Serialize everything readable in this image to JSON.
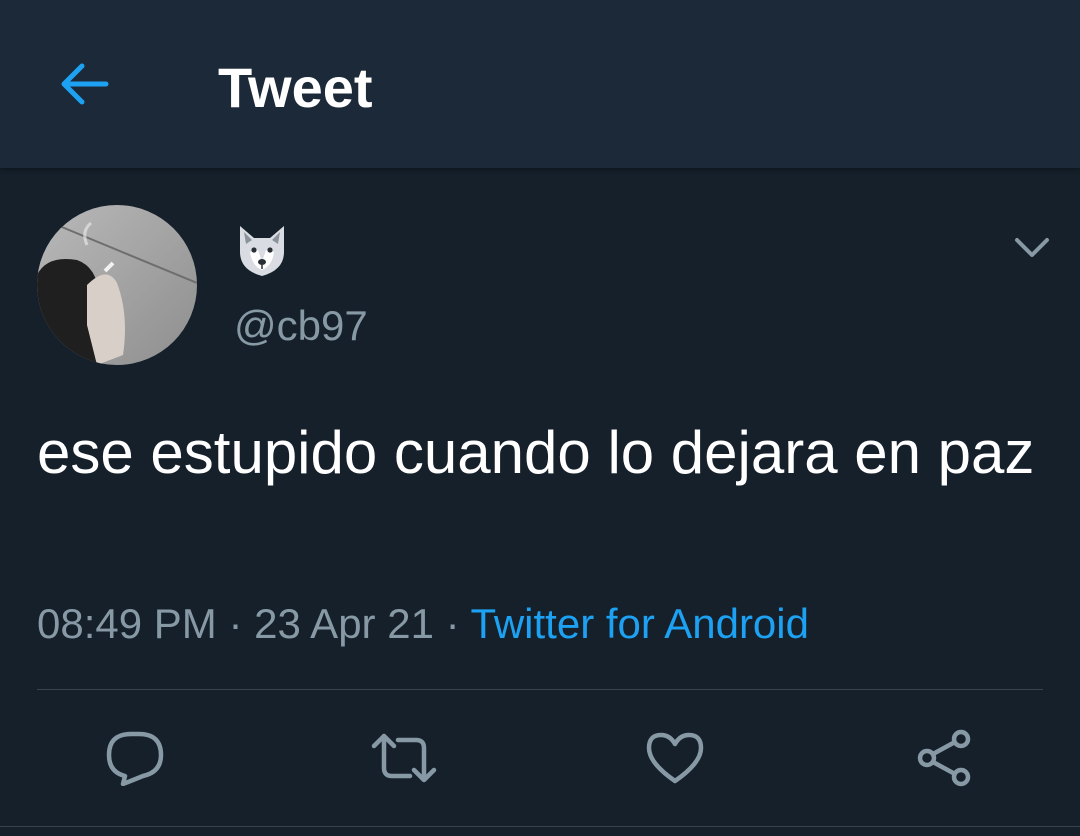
{
  "header": {
    "title": "Tweet",
    "back_icon": "arrow-left-icon"
  },
  "tweet": {
    "display_name_icon": "wolf-face-emoji",
    "handle": "@cb97",
    "text": "ese estupido cuando lo dejara en paz",
    "time": "08:49 PM",
    "separator": " · ",
    "date": "23 Apr 21",
    "source": "Twitter for Android"
  },
  "actions": [
    {
      "name": "reply",
      "icon": "speech-bubble-icon"
    },
    {
      "name": "retweet",
      "icon": "retweet-icon"
    },
    {
      "name": "like",
      "icon": "heart-icon"
    },
    {
      "name": "share",
      "icon": "share-icon"
    }
  ],
  "colors": {
    "background": "#15202b",
    "header_background": "#1c2938",
    "accent": "#1da1f2",
    "secondary_text": "#8899a6",
    "primary_text": "#ffffff",
    "divider": "#38444d"
  }
}
